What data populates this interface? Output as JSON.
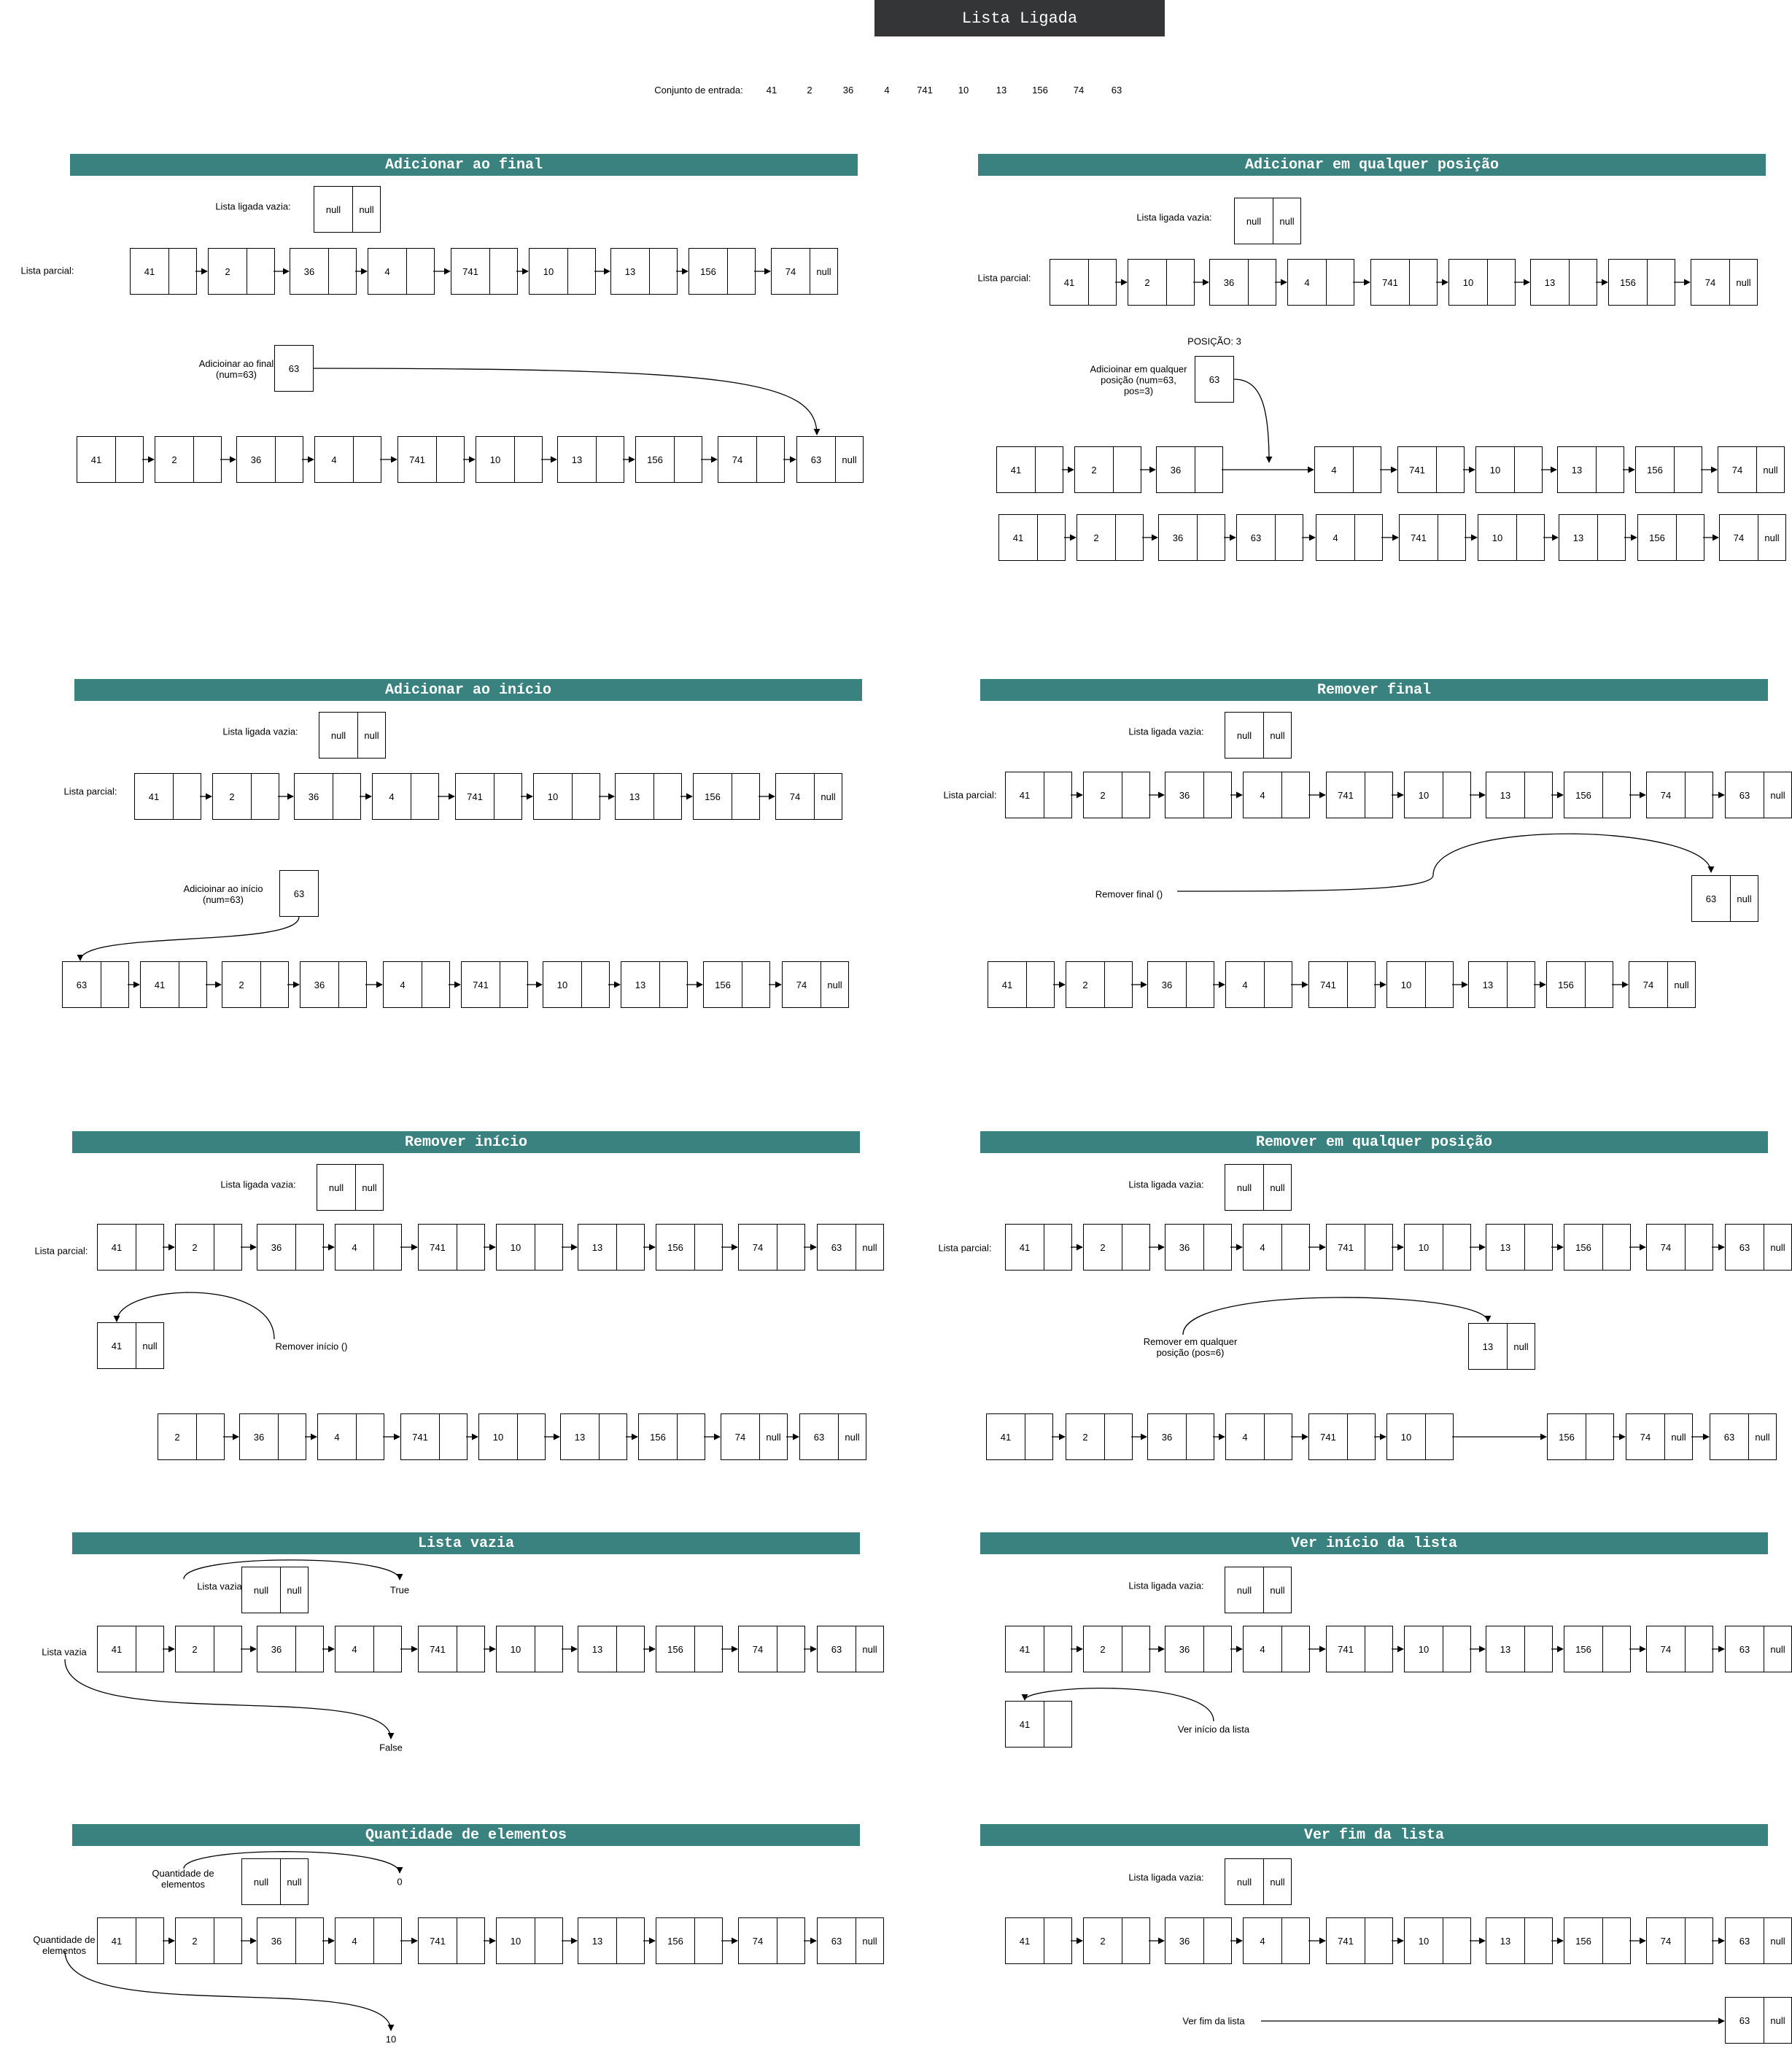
{
  "title": "Lista Ligada",
  "input": {
    "label": "Conjunto de entrada:",
    "values": [
      "41",
      "2",
      "36",
      "4",
      "741",
      "10",
      "13",
      "156",
      "74",
      "63"
    ]
  },
  "common": {
    "empty_list_label": "Lista ligada vazia:",
    "partial_list_label": "Lista parcial:",
    "null_text": "null"
  },
  "sections": [
    {
      "id": "add-end",
      "title": "Adicionar ao final",
      "operation": "Adicioinar ao final\n(num=63)",
      "new_value": "63"
    },
    {
      "id": "add-any",
      "title": "Adicionar em qualquer posição",
      "operation": "Adicioinar em qualquer\nposição (num=63,\npos=3)",
      "position_note": "POSIÇÃO: 3",
      "new_value": "63"
    },
    {
      "id": "add-start",
      "title": "Adicionar ao início",
      "operation": "Adicioinar ao início\n(num=63)",
      "new_value": "63"
    },
    {
      "id": "remove-end",
      "title": "Remover final",
      "operation": "Remover final ()",
      "removed_value": "63"
    },
    {
      "id": "remove-start",
      "title": "Remover início",
      "operation": "Remover início ()",
      "removed_value": "41"
    },
    {
      "id": "remove-any",
      "title": "Remover em qualquer posição",
      "operation": "Remover em qualquer\nposição (pos=6)",
      "removed_value": "13"
    },
    {
      "id": "empty",
      "title": "Lista vazia",
      "query_label": "Lista vazia",
      "result_empty": "True",
      "result_full": "False"
    },
    {
      "id": "peek-start",
      "title": "Ver início da lista",
      "operation": "Ver início da lista",
      "result_value": "41"
    },
    {
      "id": "count",
      "title": "Quantidade de elementos",
      "query_label": "Quantidade de\nelementos",
      "result_empty": "0",
      "result_full": "10"
    },
    {
      "id": "peek-end",
      "title": "Ver fim da lista",
      "operation": "Ver fim da lista",
      "result_value": "63"
    }
  ]
}
